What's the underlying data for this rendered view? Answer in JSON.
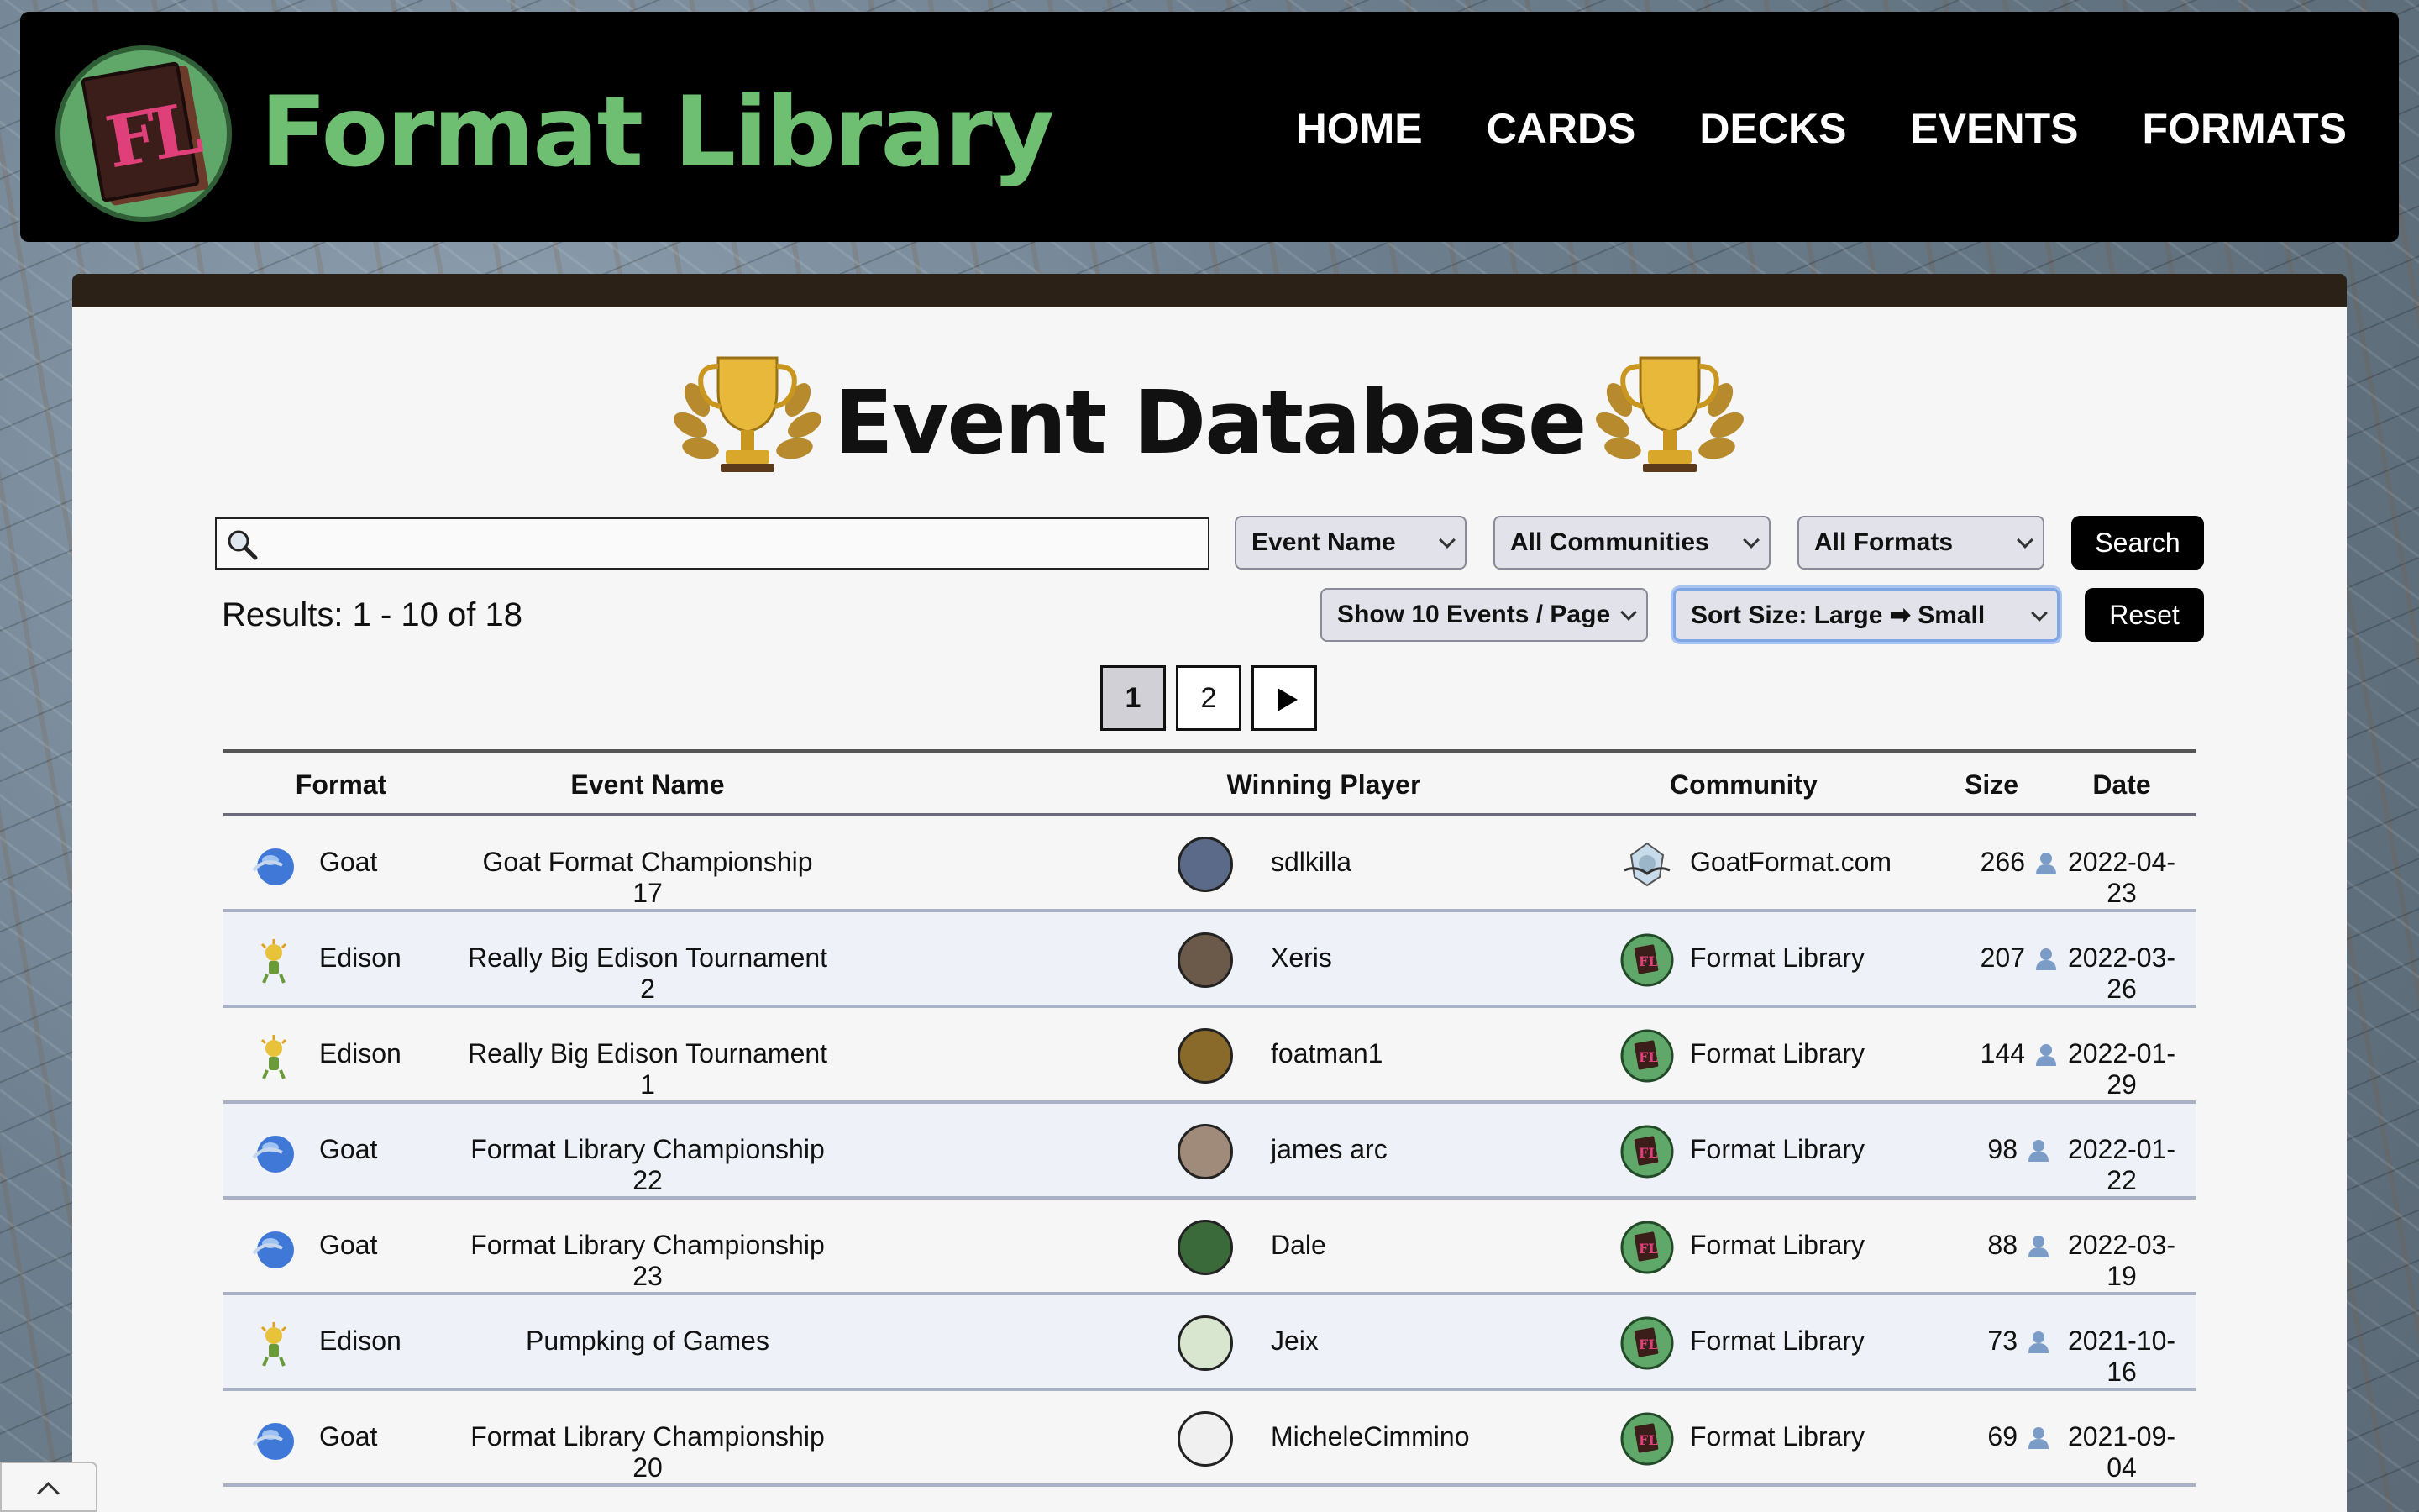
{
  "brand": {
    "name": "Format Library",
    "logo_text": "FL"
  },
  "nav": [
    "HOME",
    "CARDS",
    "DECKS",
    "EVENTS",
    "FORMATS"
  ],
  "page": {
    "title": "Event Database"
  },
  "search": {
    "value": "",
    "placeholder": ""
  },
  "filters": {
    "field": "Event Name",
    "community": "All Communities",
    "format": "All Formats",
    "per_page": "Show 10 Events / Page",
    "sort": "Sort Size: Large ➡ Small",
    "search_label": "Search",
    "reset_label": "Reset"
  },
  "results": "Results: 1 - 10 of 18",
  "pagination": {
    "pages": [
      "1",
      "2"
    ],
    "current": "1"
  },
  "table": {
    "headers": [
      "Format",
      "Event Name",
      "Winning Player",
      "Community",
      "Size",
      "Date"
    ],
    "rows": [
      {
        "format": "Goat",
        "event": "Goat Format Championship 17",
        "player": "sdlkilla",
        "community": "GoatFormat.com",
        "size": "266",
        "date": "2022-04-23"
      },
      {
        "format": "Edison",
        "event": "Really Big Edison Tournament 2",
        "player": "Xeris",
        "community": "Format Library",
        "size": "207",
        "date": "2022-03-26"
      },
      {
        "format": "Edison",
        "event": "Really Big Edison Tournament 1",
        "player": "foatman1",
        "community": "Format Library",
        "size": "144",
        "date": "2022-01-29"
      },
      {
        "format": "Goat",
        "event": "Format Library Championship 22",
        "player": "james arc",
        "community": "Format Library",
        "size": "98",
        "date": "2022-01-22"
      },
      {
        "format": "Goat",
        "event": "Format Library Championship 23",
        "player": "Dale",
        "community": "Format Library",
        "size": "88",
        "date": "2022-03-19"
      },
      {
        "format": "Edison",
        "event": "Pumpking of Games",
        "player": "Jeix",
        "community": "Format Library",
        "size": "73",
        "date": "2021-10-16"
      },
      {
        "format": "Goat",
        "event": "Format Library Championship 20",
        "player": "MicheleCimmino",
        "community": "Format Library",
        "size": "69",
        "date": "2021-09-04"
      }
    ]
  },
  "colors": {
    "brand_green": "#6fbf73",
    "navbar": "#000000",
    "row_alt": "#eef1f7"
  }
}
